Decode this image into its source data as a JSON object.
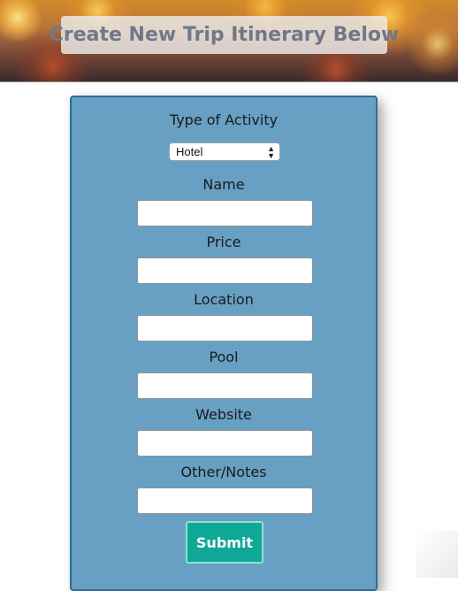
{
  "header": {
    "title": "Create New Trip Itinerary Below"
  },
  "form": {
    "activity_type_label": "Type of Activity",
    "activity_type_value": "Hotel",
    "activity_type_options": [
      "Hotel"
    ],
    "fields": [
      {
        "label": "Name",
        "value": "",
        "placeholder": ""
      },
      {
        "label": "Price",
        "value": "",
        "placeholder": ""
      },
      {
        "label": "Location",
        "value": "",
        "placeholder": ""
      },
      {
        "label": "Pool",
        "value": "",
        "placeholder": ""
      },
      {
        "label": "Website",
        "value": "",
        "placeholder": ""
      },
      {
        "label": "Other/Notes",
        "value": "",
        "placeholder": ""
      }
    ],
    "submit_label": "Submit"
  },
  "colors": {
    "panel_bg": "#68a0c4",
    "panel_border": "#2e6d9a",
    "submit_bg": "#0fa897",
    "title_text": "#707888"
  }
}
